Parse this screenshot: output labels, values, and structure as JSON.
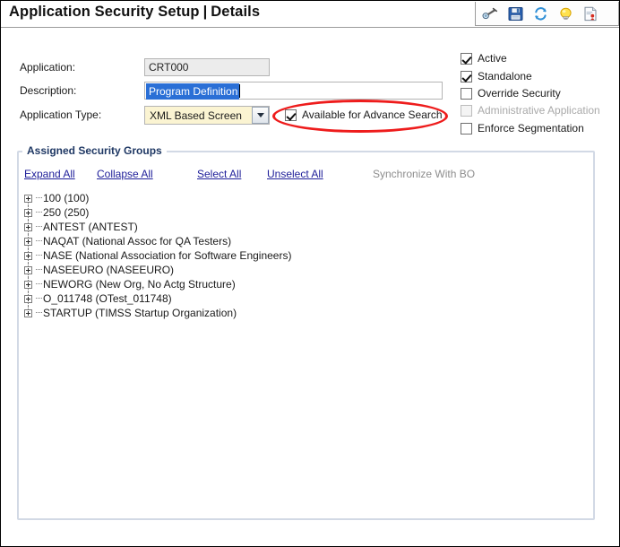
{
  "header": {
    "title_main": "Application Security Setup",
    "separator": "|",
    "title_sub": "Details"
  },
  "toolbar": {
    "items": [
      {
        "name": "binoculars-icon",
        "tooltip": "Search"
      },
      {
        "name": "save-icon",
        "tooltip": "Save"
      },
      {
        "name": "refresh-icon",
        "tooltip": "Refresh"
      },
      {
        "name": "lightbulb-icon",
        "tooltip": "Hint"
      },
      {
        "name": "report-icon",
        "tooltip": "Report"
      }
    ]
  },
  "form": {
    "application": {
      "label": "Application:",
      "value": "CRT000",
      "readonly": true
    },
    "description": {
      "label": "Description:",
      "value": "Program Definition",
      "selected": true
    },
    "application_type": {
      "label": "Application Type:",
      "value": "XML Based Screen"
    }
  },
  "options": {
    "active": {
      "label": "Active",
      "checked": true,
      "disabled": false
    },
    "standalone": {
      "label": "Standalone",
      "checked": true,
      "disabled": false
    },
    "override_security": {
      "label": "Override Security",
      "checked": false,
      "disabled": false
    },
    "administrative_application": {
      "label": "Administrative Application",
      "checked": false,
      "disabled": true
    },
    "enforce_segmentation": {
      "label": "Enforce Segmentation",
      "checked": false,
      "disabled": false
    },
    "available_for_advance_search": {
      "label": "Available for Advance Search",
      "checked": true,
      "disabled": false,
      "highlighted": true
    }
  },
  "security_groups_panel": {
    "legend": "Assigned Security Groups",
    "actions": {
      "expand_all": "Expand All",
      "collapse_all": "Collapse All",
      "select_all": "Select All",
      "unselect_all": "Unselect All",
      "synchronize_with_bo": "Synchronize With BO"
    },
    "tree": [
      {
        "label": "100 (100)",
        "expanded": false
      },
      {
        "label": "250 (250)",
        "expanded": false
      },
      {
        "label": "ANTEST (ANTEST)",
        "expanded": false
      },
      {
        "label": "NAQAT (National Assoc for QA Testers)",
        "expanded": false
      },
      {
        "label": "NASE (National Association for Software Engineers)",
        "expanded": false
      },
      {
        "label": "NASEEURO (NASEEURO)",
        "expanded": false
      },
      {
        "label": "NEWORG (New Org, No Actg Structure)",
        "expanded": false
      },
      {
        "label": "O_011748 (OTest_011748)",
        "expanded": false
      },
      {
        "label": "STARTUP (TIMSS Startup Organization)",
        "expanded": false
      }
    ]
  },
  "colors": {
    "link": "#20209a",
    "legend": "#1f3864",
    "annotation": "#ee1c1c",
    "selection": "#2a6fd6",
    "combo_background": "#fbf4d2",
    "readonly_background": "#ececec",
    "panel_border": "#d2d9e5",
    "disabled_text": "#a9a9a9"
  }
}
